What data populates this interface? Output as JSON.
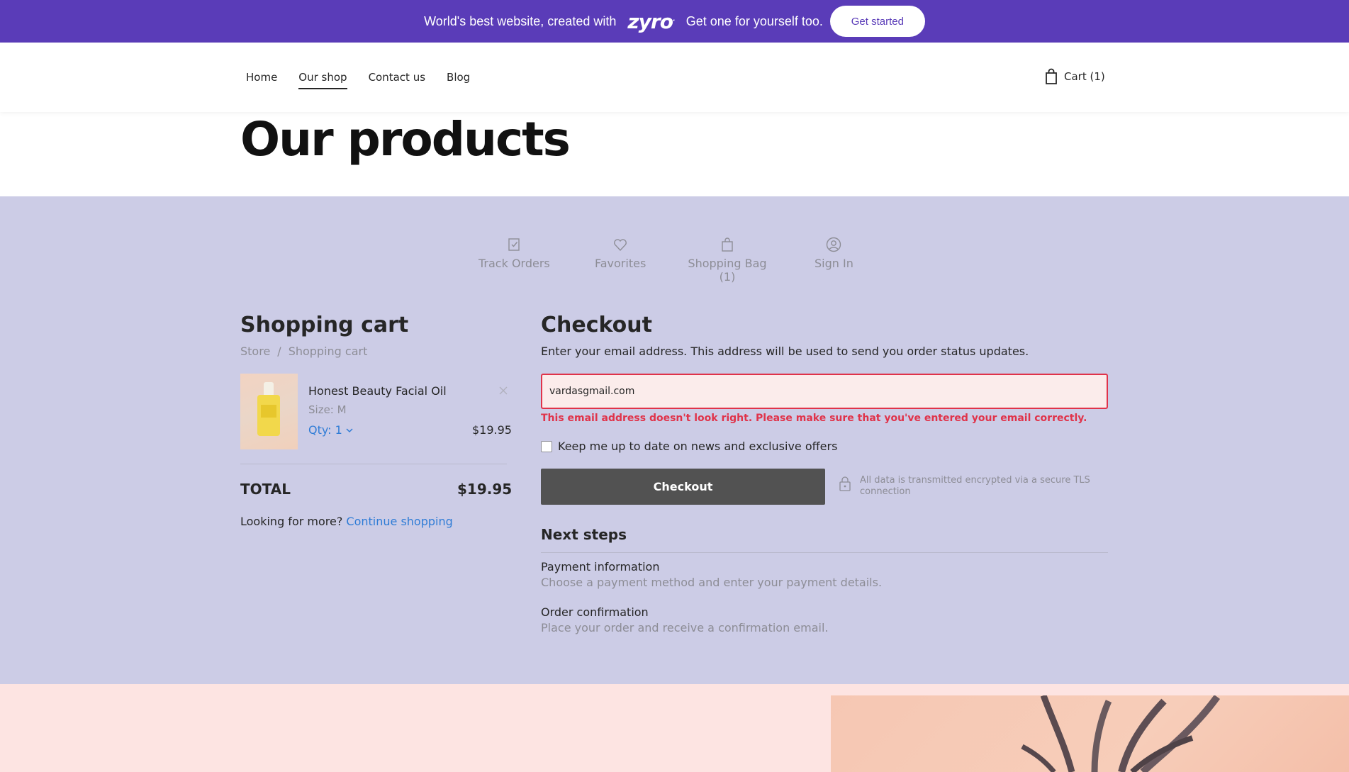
{
  "promo": {
    "text_before": "World's best website, created with",
    "logo": "zyro",
    "text_after": "Get one for yourself too.",
    "cta": "Get started"
  },
  "nav": {
    "items": [
      "Home",
      "Our shop",
      "Contact us",
      "Blog"
    ],
    "active": "Our shop",
    "cart": "Cart (1)"
  },
  "page": {
    "title": "Our products"
  },
  "account_bar": {
    "track": "Track Orders",
    "favorites": "Favorites",
    "bag": "Shopping Bag",
    "bag_count": "(1)",
    "signin": "Sign In"
  },
  "cart": {
    "title": "Shopping cart",
    "breadcrumb": [
      "Store",
      "Shopping cart"
    ],
    "item": {
      "name": "Honest Beauty Facial Oil",
      "size": "Size: M",
      "qty": "Qty: 1",
      "price": "$19.95"
    },
    "total_label": "TOTAL",
    "total_value": "$19.95",
    "more_text": "Looking for more?",
    "more_link": "Continue shopping"
  },
  "checkout": {
    "title": "Checkout",
    "description": "Enter your email address. This address will be used to send you order status updates.",
    "email_value": "vardasgmail.com",
    "error": "This email address doesn't look right. Please make sure that you've entered your email correctly.",
    "newsletter": "Keep me up to date on news and exclusive offers",
    "button": "Checkout",
    "secure": "All data is transmitted encrypted via a secure TLS connection",
    "next_steps_title": "Next steps",
    "steps": [
      {
        "title": "Payment information",
        "desc": "Choose a payment method and enter your payment details."
      },
      {
        "title": "Order confirmation",
        "desc": "Place your order and receive a confirmation email."
      }
    ]
  },
  "colors": {
    "promo_bg": "#5a3cb8",
    "section_bg": "#cccce6",
    "error": "#e0334a",
    "link": "#2f7cd6",
    "button_bg": "#525252",
    "bottom_bg": "#fde4e2"
  },
  "icons": [
    "cart-icon",
    "track-orders-icon",
    "heart-icon",
    "bag-icon",
    "user-icon",
    "close-icon",
    "chevron-down-icon",
    "lock-icon"
  ]
}
